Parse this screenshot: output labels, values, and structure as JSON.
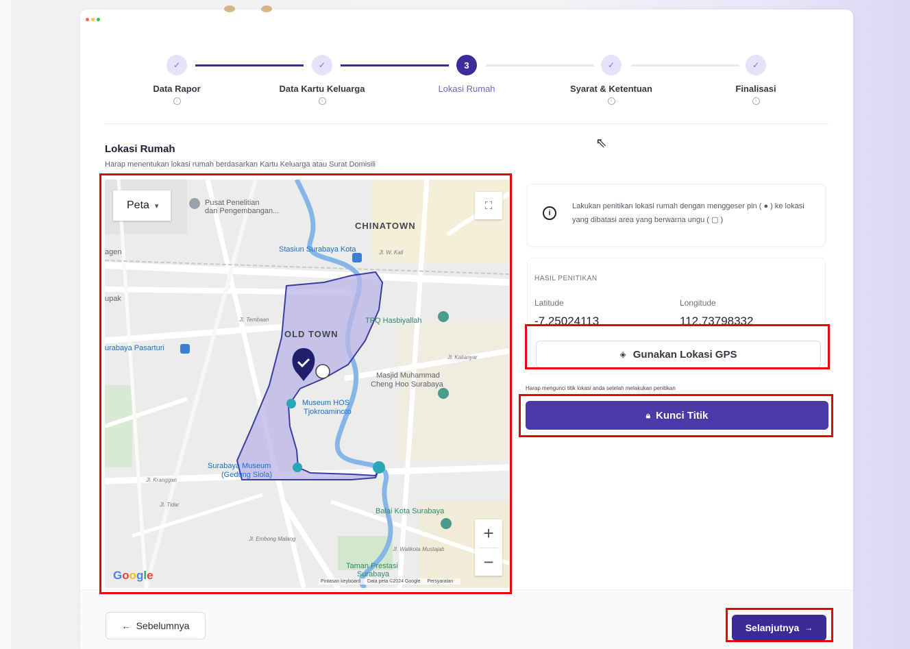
{
  "stepper": {
    "steps": [
      {
        "label": "Data Rapor",
        "state": "done",
        "icon": "check-icon"
      },
      {
        "label": "Data Kartu Keluarga",
        "state": "done",
        "icon": "check-icon"
      },
      {
        "label": "Lokasi Rumah",
        "state": "active",
        "number": "3"
      },
      {
        "label": "Syarat & Ketentuan",
        "state": "done",
        "icon": "check-icon"
      },
      {
        "label": "Finalisasi",
        "state": "done",
        "icon": "check-icon"
      }
    ]
  },
  "section": {
    "title": "Lokasi Rumah",
    "subtitle": "Harap menentukan lokasi rumah berdasarkan Kartu Keluarga atau Surat Domisili"
  },
  "map": {
    "type_select": "Peta",
    "labels": {
      "chinatown": "CHINATOWN",
      "old_town": "OLD TOWN",
      "pusat": "Pusat Penelitian",
      "pusat2": "dan Pengembangan...",
      "stasiun": "Stasiun Surabaya Kota",
      "hasbiyallah": "TPQ Hasbiyallah",
      "masjid": "Masjid Muhammad",
      "masjid2": "Cheng Hoo Surabaya",
      "museum_hos": "Museum HOS",
      "museum_hos2": "Tjokroaminoto",
      "surabaya_museum": "Surabaya Museum",
      "surabaya_museum2": "(Gedung Siola)",
      "balai": "Balai Kota Surabaya",
      "taman": "Taman Prestasi",
      "taman2": "Surabaya",
      "pasarturi": "urabaya Pasarturi",
      "agen": "agen",
      "supak": "upak",
      "krampan": "Jl. Kranggan",
      "tidar": "Jl. Tidar",
      "embong": "Jl. Embong Malang",
      "walikota": "Jl. Walikota Mustajab",
      "kalianyar": "Jl. Kalianyar",
      "tembaan": "Jl. Tembaan",
      "kh": "Jl. W. Kali"
    },
    "attribution": [
      "Pintasan keyboard",
      "Data peta ©2024 Google",
      "Persyaratan"
    ],
    "google_logo": "Google"
  },
  "info": {
    "text": "Lakukan penitikan lokasi rumah dengan menggeser pin ( ● ) ke lokasi yang dibatasi area yang berwarna ungu ( ▢ )"
  },
  "result": {
    "title": "HASIL PENITIKAN",
    "lat_label": "Latitude",
    "lat_value": "-7.25024113",
    "lng_label": "Longitude",
    "lng_value": "112.73798332",
    "gps_button": "Gunakan Lokasi GPS"
  },
  "lock": {
    "hint": "Harap mengunci titik lokasi anda setelah melakukan penitikan",
    "button": "Kunci Titik"
  },
  "footer": {
    "prev": "Sebelumnya",
    "next": "Selanjutnya"
  },
  "colors": {
    "primary": "#3b2c95",
    "active_step": "#6c63d1",
    "highlight": "#e8000b",
    "polygon_fill": "#b9b4ea"
  }
}
